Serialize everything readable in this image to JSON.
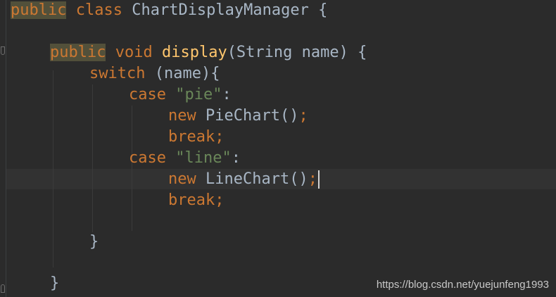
{
  "code": {
    "line1": {
      "kw_public": "public",
      "kw_class": "class",
      "class_name": "ChartDisplayManager",
      "brace": "{"
    },
    "line3": {
      "kw_public": "public",
      "kw_void": "void",
      "method": "display",
      "params": "(String name)",
      "brace": "{"
    },
    "line4": {
      "kw_switch": "switch",
      "rest": "(name){"
    },
    "line5": {
      "kw_case": "case",
      "value": "\"pie\"",
      "colon": ":"
    },
    "line6": {
      "kw_new": "new",
      "call": "PieChart()",
      "semicolon": ";"
    },
    "line7": {
      "kw_break": "break;"
    },
    "line8": {
      "kw_case": "case",
      "value": "\"line\"",
      "colon": ":"
    },
    "line9": {
      "kw_new": "new",
      "call": "LineChart()",
      "semicolon": ";"
    },
    "line10": {
      "kw_break": "break;"
    },
    "line12": {
      "brace": "}"
    },
    "line14": {
      "brace": "}"
    }
  },
  "watermark": "https://blog.csdn.net/yuejunfeng1993",
  "colors": {
    "background": "#2b2b2b",
    "keyword": "#cc7832",
    "method": "#ffc66d",
    "string": "#6a8759",
    "text": "#a9b7c6",
    "current_line": "#323232"
  }
}
